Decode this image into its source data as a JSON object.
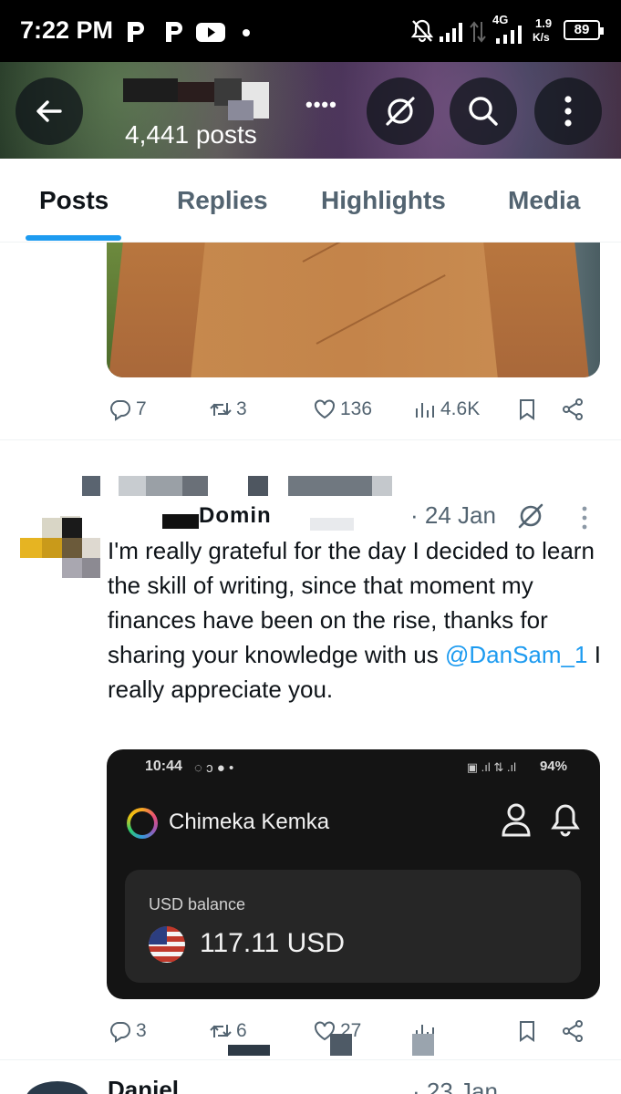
{
  "status_bar": {
    "time": "7:22 PM",
    "network": "4G",
    "speed": "1.9",
    "speed_unit": "K/s",
    "battery": "89"
  },
  "header": {
    "posts_count": "4,441 posts",
    "name_suffix": "••••"
  },
  "tabs": [
    {
      "label": "Posts",
      "active": true
    },
    {
      "label": "Replies",
      "active": false
    },
    {
      "label": "Highlights",
      "active": false
    },
    {
      "label": "Media",
      "active": false
    }
  ],
  "post1_actions": {
    "replies": "7",
    "reposts": "3",
    "likes": "136",
    "views": "4.6K"
  },
  "tweet": {
    "handle": "Domin",
    "date": "· 24 Jan",
    "text_before": "I'm really grateful for the day I decided to learn the skill of writing, since that moment my finances have been on the rise, thanks for sharing your knowledge with us ",
    "mention": "@DanSam_1",
    "text_after": " I really appreciate you.",
    "embed": {
      "status_time": "10:44",
      "status_battery": "94%",
      "account_name": "Chimeka Kemka",
      "balance_label": "USD balance",
      "balance_amount": "117.11 USD"
    },
    "actions": {
      "replies": "3",
      "reposts": "6",
      "likes": "27"
    }
  },
  "next_tweet": {
    "name": "Daniel",
    "date": "· 23 Jan"
  },
  "colors": {
    "accent": "#1d9bf0",
    "secondary_text": "#536471"
  }
}
